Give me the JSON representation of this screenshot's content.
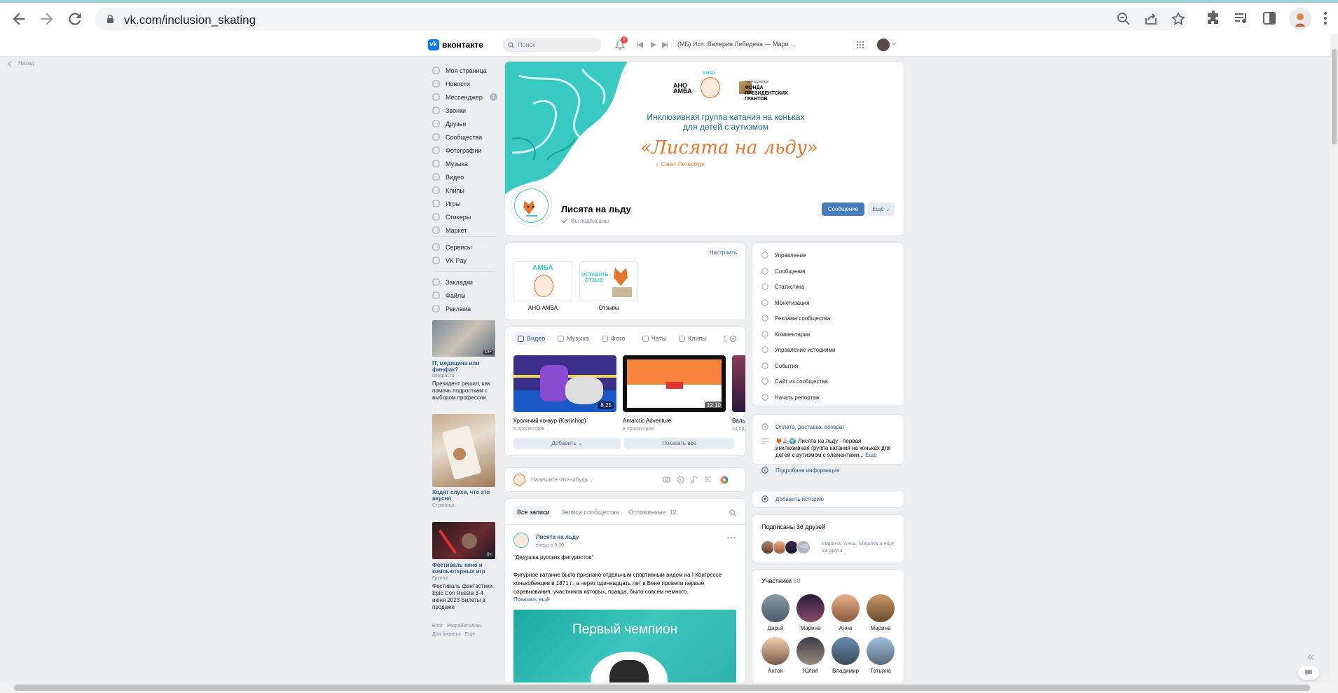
{
  "browser": {
    "url": "vk.com/inclusion_skating",
    "icons": [
      "back-icon",
      "forward-icon",
      "reload-icon",
      "lock-icon",
      "zoom-icon",
      "share-icon",
      "star-icon",
      "extensions-icon",
      "media-icon",
      "sidebar-icon",
      "profile-icon",
      "menu-icon"
    ]
  },
  "header": {
    "logo_text": "вконтакте",
    "search_placeholder": "Поиск",
    "notif_count": "9",
    "player_text": "(МБ) Исп. Валерия Лебедева — Мари ..."
  },
  "back_link": "Назад",
  "nav": {
    "items": [
      {
        "label": "Моя страница",
        "icon": "user-icon"
      },
      {
        "label": "Новости",
        "icon": "news-icon"
      },
      {
        "label": "Мессенджер",
        "icon": "chat-icon",
        "badge": "1"
      },
      {
        "label": "Звонки",
        "icon": "phone-icon"
      },
      {
        "label": "Друзья",
        "icon": "friends-icon"
      },
      {
        "label": "Сообщества",
        "icon": "communities-icon"
      },
      {
        "label": "Фотографии",
        "icon": "photo-icon"
      },
      {
        "label": "Музыка",
        "icon": "music-icon"
      },
      {
        "label": "Видео",
        "icon": "video-icon"
      },
      {
        "label": "Клипы",
        "icon": "clips-icon"
      },
      {
        "label": "Игры",
        "icon": "games-icon"
      },
      {
        "label": "Стикеры",
        "icon": "sticker-icon"
      },
      {
        "label": "Маркет",
        "icon": "market-icon"
      }
    ],
    "services": [
      {
        "label": "Сервисы",
        "icon": "services-icon"
      },
      {
        "label": "VK Pay",
        "icon": "vkpay-icon"
      }
    ],
    "extra": [
      {
        "label": "Закладки",
        "icon": "bookmark-icon"
      },
      {
        "label": "Файлы",
        "icon": "files-icon"
      },
      {
        "label": "Реклама",
        "icon": "ads-icon"
      }
    ]
  },
  "ads": [
    {
      "title": "IT, медицина или финфак?",
      "source": "telegraf.ru",
      "text": "Президент решил, как помочь подросткам с выбором профессии",
      "badge": "13+"
    },
    {
      "title": "Ходят слухи, что это вкусно",
      "source": "Страница",
      "text": ""
    },
    {
      "title": "Фестиваль кино и компьютерных игр",
      "source": "Группа",
      "text": "Фестиваль фантастики Epic Con Russia 3-4 июня 2023 Билеты в продаже",
      "badge": "0+"
    }
  ],
  "footer_links": [
    "Блог",
    "Разработчикам",
    "Для бизнеса",
    "Ещё"
  ],
  "cover": {
    "org1": "АНО АМБА",
    "amba": "АМБА",
    "grant_small": "при поддержке",
    "grant": "ФОНДА ПРЕЗИДЕНТСКИХ ГРАНТОВ",
    "line1": "Инклюзивная группа катания на коньках",
    "line2": "для детей с аутизмом",
    "big": "«Лисята на льду»",
    "city": "г. Санкт-Петербург",
    "logo_text": "Лисята на льду"
  },
  "group": {
    "name": "Лисята на льду",
    "subscribed": "Вы подписаны",
    "message_btn": "Сообщение",
    "more_btn": "Ещё"
  },
  "links": {
    "setup": "Настроить",
    "items": [
      {
        "label": "АНО АМБА",
        "img_text": "АМБА"
      },
      {
        "label": "Отзывы",
        "img_text": "ОСТАВИТЬ ОТЗЫВ"
      }
    ]
  },
  "media": {
    "tabs": [
      "Видео",
      "Музыка",
      "Фото",
      "Чаты",
      "Клипы"
    ],
    "videos": [
      {
        "title": "Кроличий конкур (Kaninhop)",
        "views": "5 просмотров",
        "duration": "8:25"
      },
      {
        "title": "Antarctic Adventure",
        "views": "8 просмотров",
        "duration": "12:10"
      },
      {
        "title": "Валь",
        "views": "14 пр",
        "duration": ""
      }
    ],
    "add_btn": "Добавить",
    "show_all_btn": "Показать все"
  },
  "composer": {
    "placeholder": "Напишите что-нибудь..."
  },
  "wall": {
    "tabs": [
      "Все записи",
      "Записи сообщества",
      "Отложенные"
    ],
    "postponed_count": "12",
    "post": {
      "author": "Лисята на льду",
      "time": "вчера в 9:30",
      "title": "\"Дедушка русских фигуристов\"",
      "text": "Фигурное катание было признано отдельным спортивным видом на I Конгрессе конькобежцев в 1871 г., а через одиннадцать лет в Вене провели первые соревнования, участников которых, правда, было совсем немного.",
      "more": "Показать ещё",
      "image_text": "Первый чемпион"
    }
  },
  "manage": {
    "items": [
      {
        "label": "Управление",
        "icon": "settings-icon"
      },
      {
        "label": "Сообщения",
        "icon": "messages-icon"
      },
      {
        "label": "Статистика",
        "icon": "stats-icon"
      },
      {
        "label": "Монетизация",
        "icon": "money-icon"
      },
      {
        "label": "Реклама сообщества",
        "icon": "megaphone-icon"
      },
      {
        "label": "Комментарии",
        "icon": "comments-icon"
      },
      {
        "label": "Управление историями",
        "icon": "stories-icon"
      },
      {
        "label": "События",
        "icon": "events-icon"
      },
      {
        "label": "Сайт из сообщества",
        "icon": "site-icon"
      },
      {
        "label": "Начать репортаж",
        "icon": "live-icon"
      }
    ]
  },
  "info": {
    "payment": "Оплата, доставка, возврат",
    "desc": "🦊⛸️🌍 Лисята на льду - первая инклюзивная группа катания на коньках для детей с аутизмом с элементами...",
    "desc_more": "Ещё",
    "details": "Подробная информация"
  },
  "add_story": "Добавить историю",
  "friends": {
    "title": "Подписаны 36 друзей",
    "text": "Марина, Анна, Марина и ещё 33 друга",
    "extra": "+33"
  },
  "members": {
    "title": "Участники",
    "count": "60",
    "list": [
      "Дарья",
      "Марина",
      "Анна",
      "Марина",
      "Антон",
      "Юлия",
      "Владимир",
      "Татьяна"
    ]
  },
  "colors": {
    "accent": "#447bba",
    "link": "#2a5885",
    "teal": "#38c9c3",
    "orange": "#e8742a"
  }
}
